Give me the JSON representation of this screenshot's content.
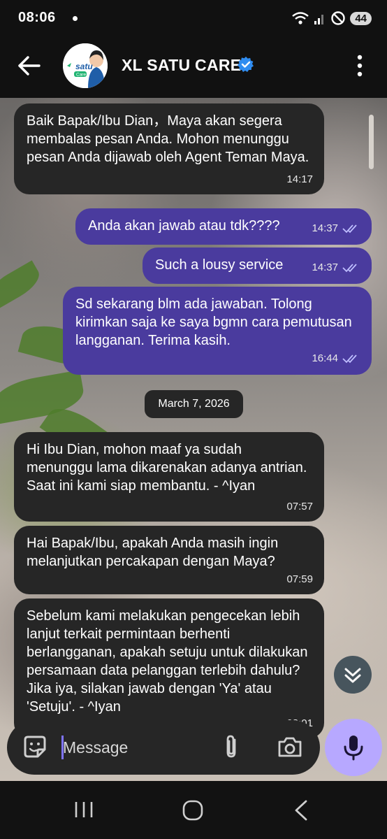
{
  "status_bar": {
    "time": "08:06",
    "battery": "44"
  },
  "header": {
    "title": "XL SATU CARE",
    "avatar_logo_text": "satu",
    "avatar_logo_subtext": "Care"
  },
  "messages": [
    {
      "direction": "in",
      "text": "Baik Bapak/Ibu Dian，Maya akan segera membalas pesan Anda. Mohon menunggu pesan Anda dijawab oleh Agent Teman Maya.",
      "time": "14:17"
    },
    {
      "direction": "out",
      "text": "Anda akan jawab atau tdk????",
      "time": "14:37",
      "read": true
    },
    {
      "direction": "out",
      "text": "Such a lousy service",
      "time": "14:37",
      "read": true
    },
    {
      "direction": "out",
      "text": "Sd sekarang blm ada jawaban. Tolong kirimkan saja ke saya bgmn cara pemutusan langganan. Terima kasih.",
      "time": "16:44",
      "read": true
    },
    {
      "direction": "in",
      "text": "Hi Ibu Dian, mohon maaf ya sudah menunggu lama dikarenakan adanya antrian. Saat ini kami siap membantu. - ^Iyan",
      "time": "07:57"
    },
    {
      "direction": "in",
      "text": "Hai Bapak/Ibu, apakah Anda masih ingin melanjutkan percakapan dengan Maya?",
      "time": "07:59"
    },
    {
      "direction": "in",
      "text": "Sebelum kami melakukan pengecekan lebih lanjut terkait permintaan berhenti berlangganan, apakah setuju untuk dilakukan persamaan data pelanggan terlebih dahulu? Jika iya, silakan jawab dengan 'Ya' atau 'Setuju'. - ^Iyan",
      "time": "08:01"
    }
  ],
  "date_divider": "March 7, 2026",
  "composer": {
    "placeholder": "Message"
  },
  "colors": {
    "incoming_bubble": "#262626",
    "outgoing_bubble": "#4a3b9e",
    "mic_button": "#b7a8ff",
    "verified_badge": "#2f8cf0"
  }
}
